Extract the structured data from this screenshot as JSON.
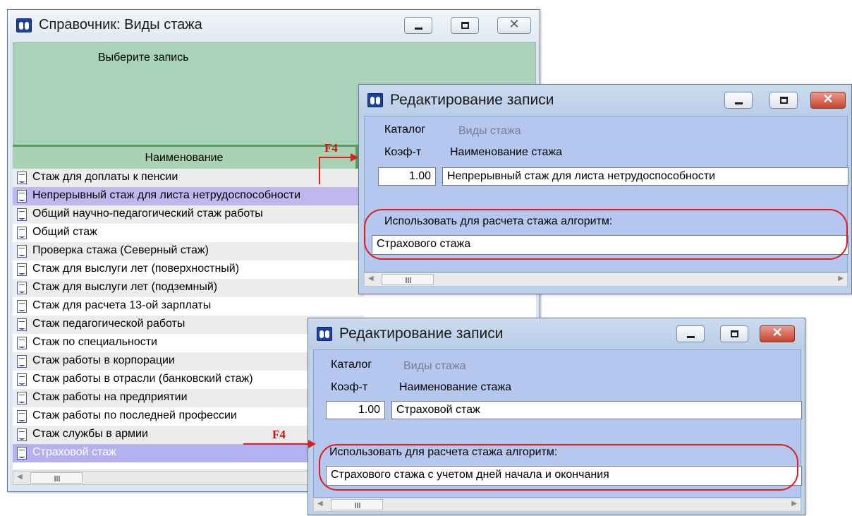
{
  "win1": {
    "title": "Справочник: Виды стажа",
    "caption": "Выберите запись",
    "column_header": "Наименование",
    "rows": [
      "Стаж для доплаты к пенсии",
      "Непрерывный стаж для листа нетрудоспособности",
      "Общий научно-педагогический стаж работы",
      "Общий стаж",
      "Проверка стажа (Северный стаж)",
      "Стаж для выслуги лет (поверхностный)",
      "Стаж для выслуги лет (подземный)",
      "Стаж для расчета 13-ой зарплаты",
      "Стаж педагогической работы",
      "Стаж по специальности",
      "Стаж работы в корпорации",
      "Стаж работы в отрасли (банковский стаж)",
      "Стаж работы на предприятии",
      "Стаж работы по последней профессии",
      "Стаж службы в армии",
      "Страховой стаж"
    ]
  },
  "edit1": {
    "title": "Редактирование записи",
    "catalog_label": "Каталог",
    "catalog_value": "Виды стажа",
    "coef_label": "Коэф-т",
    "name_label": "Наименование стажа",
    "coef_value": "1.00",
    "name_value": "Непрерывный стаж для листа нетрудоспособности",
    "algo_label": "Использовать для расчета стажа алгоритм:",
    "algo_value": "Страхового стажа"
  },
  "edit2": {
    "title": "Редактирование записи",
    "catalog_label": "Каталог",
    "catalog_value": "Виды стажа",
    "coef_label": "Коэф-т",
    "name_label": "Наименование стажа",
    "coef_value": "1.00",
    "name_value": "Страховой стаж",
    "algo_label": "Использовать для расчета стажа алгоритм:",
    "algo_value": "Страхового стажа с учетом дней начала и окончания"
  },
  "annotations": {
    "key1": "F4",
    "key2": "F4"
  },
  "icons": {
    "app": "app-logo-icon",
    "row": "document-icon",
    "minimize": "minimize-icon",
    "maximize": "maximize-icon",
    "close": "close-icon"
  },
  "colors": {
    "selection_green": "#a9d2bb",
    "header_green": "#58a05c",
    "row_selected": "#bfb8ee",
    "annotation_red": "#e21b1b",
    "dialog_blue": "#b5c7ee"
  }
}
